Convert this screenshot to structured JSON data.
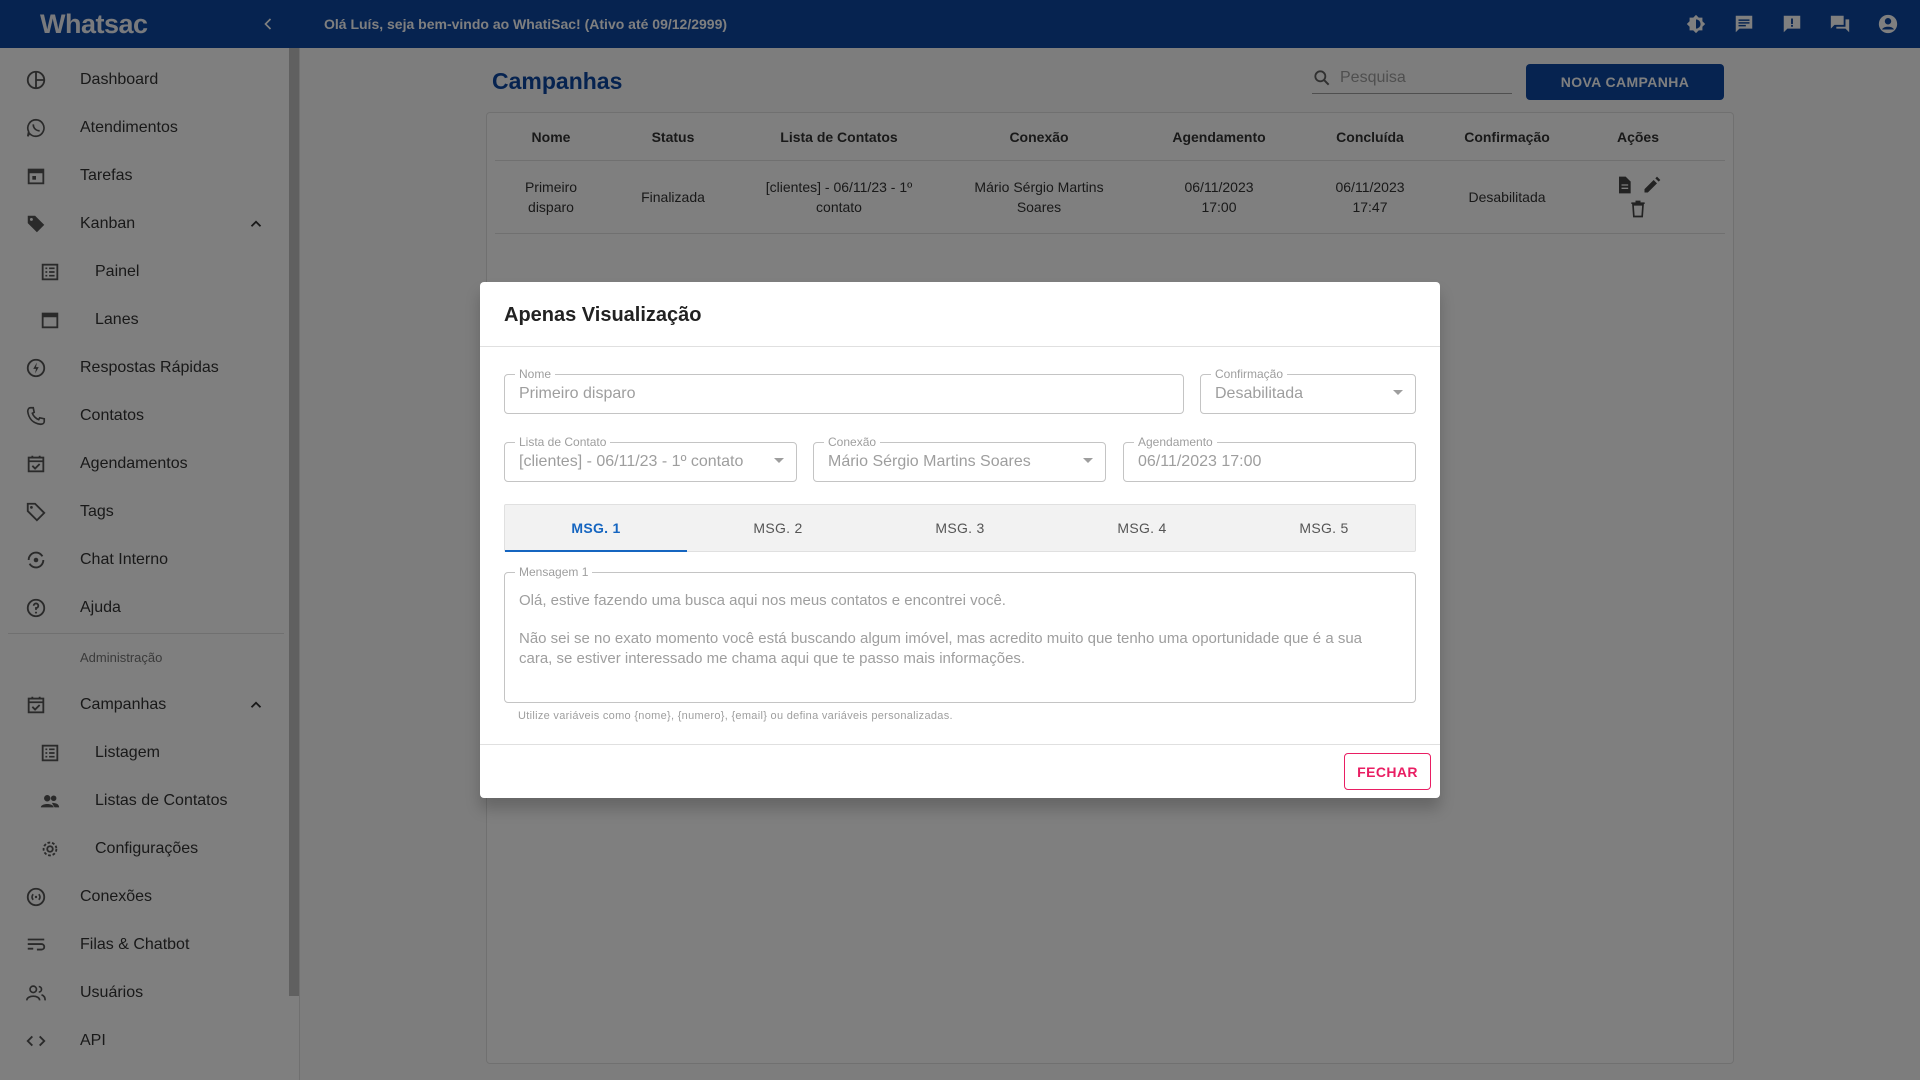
{
  "app": {
    "logo_text": "Whatsac",
    "welcome": "Olá Luís, seja bem-vindo ao WhatiSac! (Ativo até 09/12/2999)"
  },
  "topbar_icons": [
    "brightness-icon",
    "chat-icon",
    "announcement-icon",
    "forum-icon",
    "account-circle-icon"
  ],
  "sidebar": {
    "items": [
      {
        "label": "Dashboard",
        "icon": "dashboard-icon"
      },
      {
        "label": "Atendimentos",
        "icon": "whatsapp-icon"
      },
      {
        "label": "Tarefas",
        "icon": "calendar-icon"
      },
      {
        "label": "Kanban",
        "icon": "tag-icon"
      },
      {
        "label": "Painel",
        "icon": "list-icon"
      },
      {
        "label": "Lanes",
        "icon": "calendar-icon"
      },
      {
        "label": "Respostas Rápidas",
        "icon": "bolt-icon"
      },
      {
        "label": "Contatos",
        "icon": "phone-icon"
      },
      {
        "label": "Agendamentos",
        "icon": "event-icon"
      },
      {
        "label": "Tags",
        "icon": "tag-icon"
      },
      {
        "label": "Chat Interno",
        "icon": "chat-sync-icon"
      },
      {
        "label": "Ajuda",
        "icon": "help-icon"
      },
      {
        "label": "Campanhas",
        "icon": "event-icon"
      },
      {
        "label": "Listagem",
        "icon": "list-icon"
      },
      {
        "label": "Listas de Contatos",
        "icon": "people-icon"
      },
      {
        "label": "Configurações",
        "icon": "gear-icon"
      },
      {
        "label": "Conexões",
        "icon": "signal-icon"
      },
      {
        "label": "Filas & Chatbot",
        "icon": "queue-icon"
      },
      {
        "label": "Usuários",
        "icon": "users-icon"
      },
      {
        "label": "API",
        "icon": "code-icon"
      }
    ],
    "admin_header": "Administração"
  },
  "main": {
    "title": "Campanhas",
    "search_placeholder": "Pesquisa",
    "new_button": "NOVA CAMPANHA",
    "table": {
      "headers": [
        "Nome",
        "Status",
        "Lista de Contatos",
        "Conexão",
        "Agendamento",
        "Concluída",
        "Confirmação",
        "Ações"
      ],
      "rows": [
        {
          "nome": "Primeiro disparo",
          "status": "Finalizada",
          "lista": "[clientes] - 06/11/23 - 1º contato",
          "conexao": "Mário Sérgio Martins Soares",
          "agendamento": "06/11/2023 17:00",
          "concluida": "06/11/2023 17:47",
          "confirmacao": "Desabilitada"
        }
      ]
    }
  },
  "dialog": {
    "title": "Apenas Visualização",
    "fields": {
      "nome": {
        "label": "Nome",
        "value": "Primeiro disparo"
      },
      "confirmacao": {
        "label": "Confirmação",
        "value": "Desabilitada"
      },
      "lista": {
        "label": "Lista de Contato",
        "value": "[clientes] - 06/11/23 - 1º contato"
      },
      "conexao": {
        "label": "Conexão",
        "value": "Mário Sérgio Martins Soares"
      },
      "agendamento": {
        "label": "Agendamento",
        "value": "06/11/2023 17:00"
      }
    },
    "tabs": [
      "MSG. 1",
      "MSG. 2",
      "MSG. 3",
      "MSG. 4",
      "MSG. 5"
    ],
    "active_tab": "MSG. 1",
    "message": {
      "label": "Mensagem 1",
      "line1": "Olá, estive fazendo uma busca aqui nos meus contatos e encontrei você.",
      "line2": "Não sei se no exato momento você está buscando algum imóvel, mas acredito muito que tenho uma oportunidade que é a sua cara, se estiver interessado me chama aqui que te passo mais informações."
    },
    "helper": "Utilize variáveis como {nome}, {numero}, {email} ou defina variáveis personalizadas.",
    "close_button": "FECHAR"
  },
  "colors": {
    "primary": "#0d47a1",
    "tab_active": "#1565c0",
    "close": "#e91e63"
  }
}
